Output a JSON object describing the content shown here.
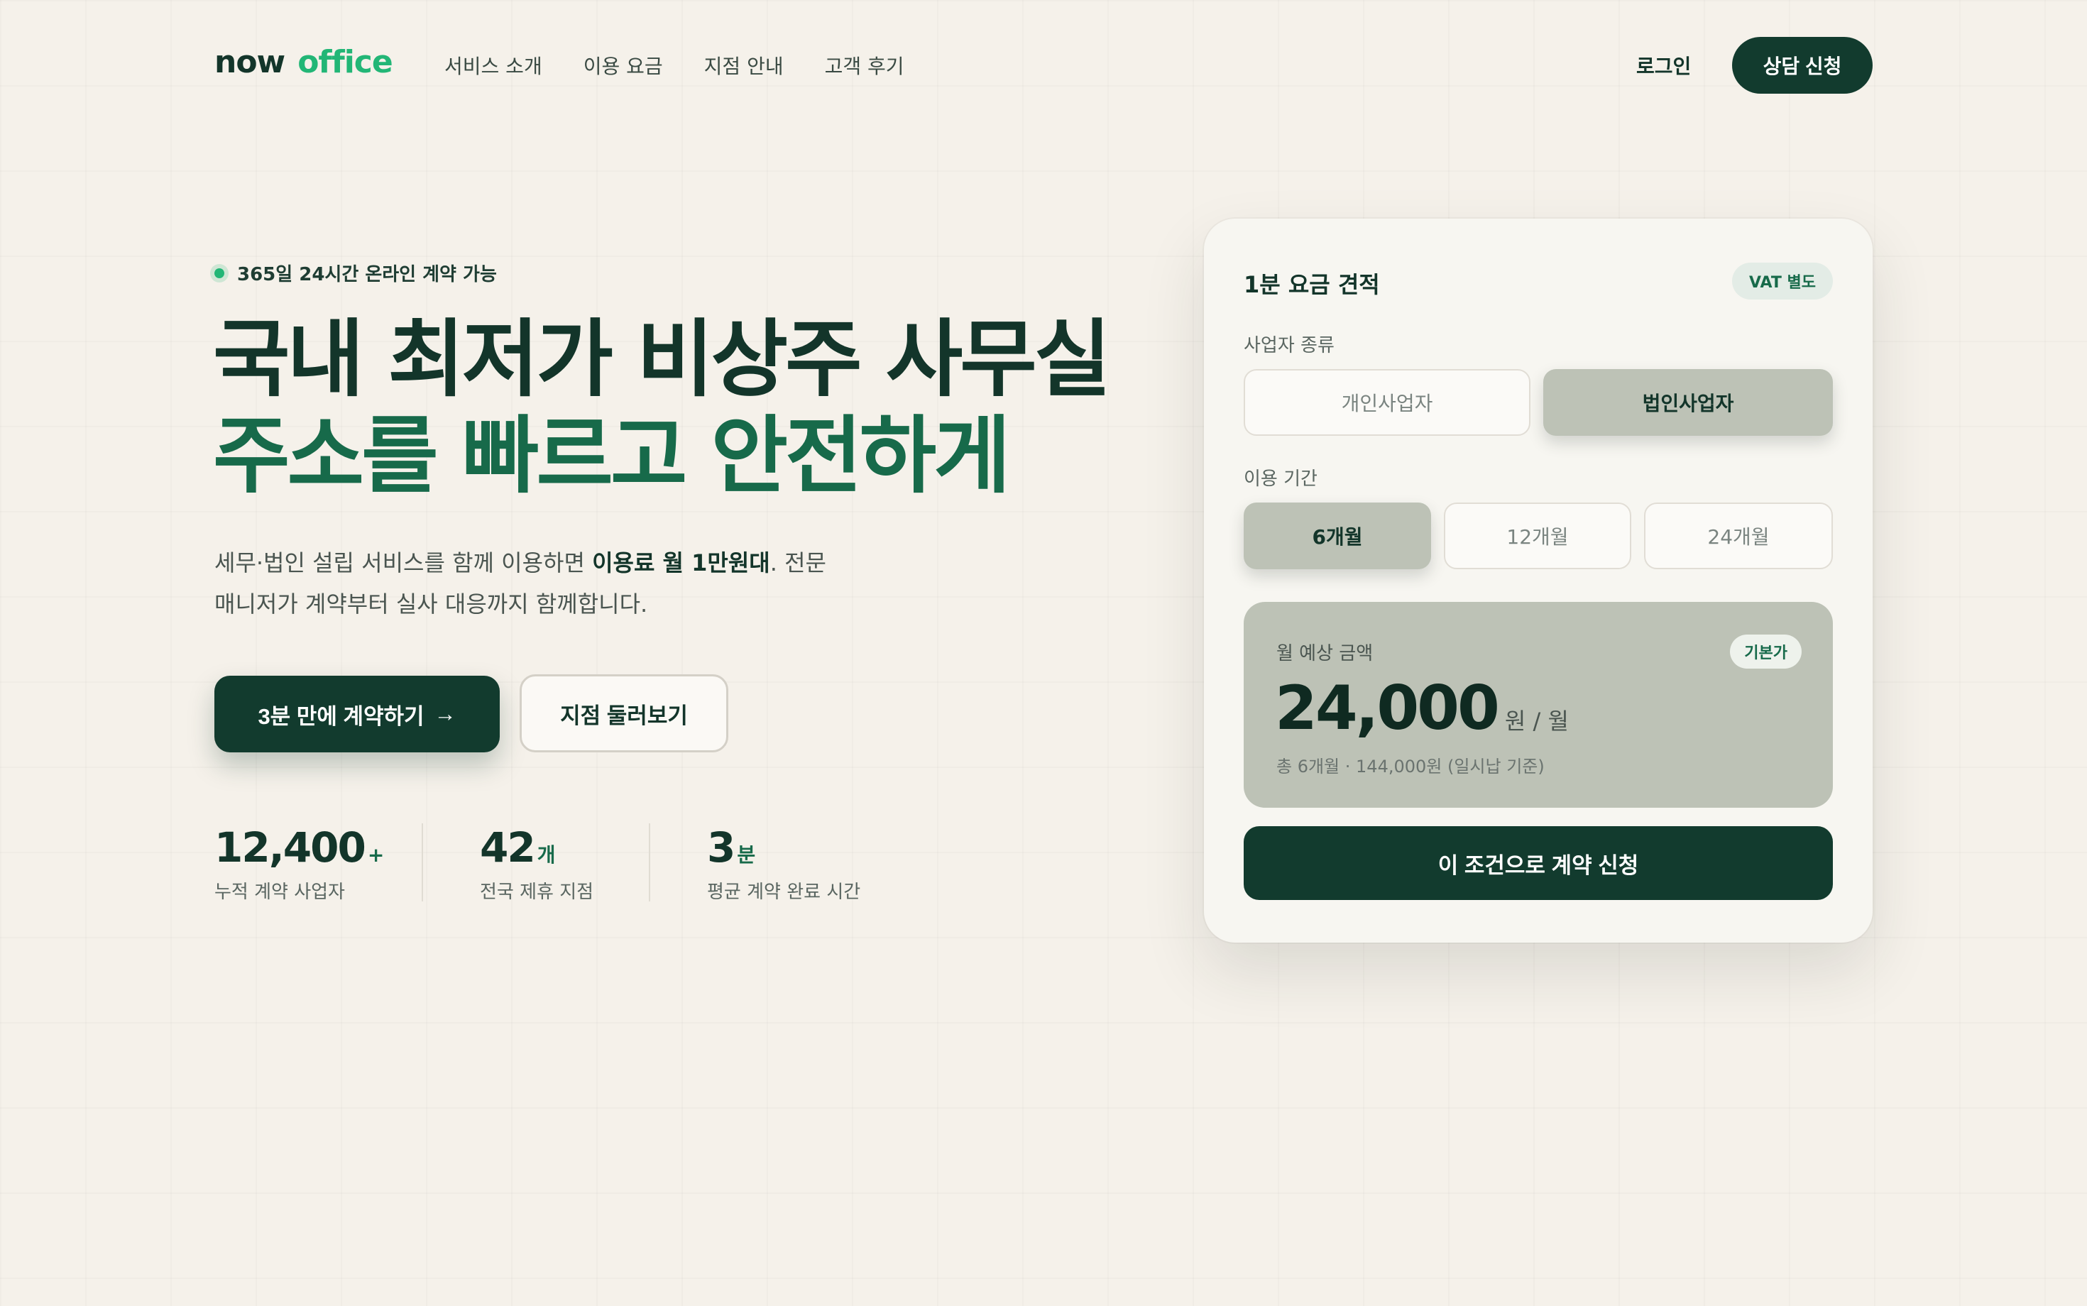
{
  "header": {
    "logo_now": "now",
    "logo_office": "office",
    "nav": [
      "서비스 소개",
      "이용 요금",
      "지점 안내",
      "고객 후기"
    ],
    "login": "로그인",
    "consult": "상담 신청"
  },
  "hero": {
    "badge": "365일 24시간 온라인 계약 가능",
    "title_line1": "국내 최저가 비상주 사무실",
    "title_line2": "주소를 빠르고 안전하게",
    "desc_prefix": "세무·법인 설립 서비스를 함께 이용하면 ",
    "desc_bold": "이용료 월 1만원대",
    "desc_suffix": ". 전문 매니저가 계약부터 실사 대응까지 함께합니다.",
    "cta_primary": "3분 만에 계약하기",
    "cta_primary_arrow": "→",
    "cta_secondary": "지점 둘러보기"
  },
  "stats": [
    {
      "value": "12,400",
      "unit": "+",
      "label": "누적 계약 사업자"
    },
    {
      "value": "42",
      "unit": "개",
      "label": "전국 제휴 지점"
    },
    {
      "value": "3",
      "unit": "분",
      "label": "평균 계약 완료 시간"
    }
  ],
  "quote": {
    "title": "1분 요금 견적",
    "vat": "VAT 별도",
    "biz_type_label": "사업자 종류",
    "biz_types": [
      "개인사업자",
      "법인사업자"
    ],
    "biz_selected": "법인사업자",
    "period_label": "이용 기간",
    "periods": [
      "6개월",
      "12개월",
      "24개월"
    ],
    "period_selected": "6개월",
    "estimate_label": "월 예상 금액",
    "base_badge": "기본가",
    "amount": "24,000",
    "amount_unit": "원 / 월",
    "amount_sub": "총 6개월 · 144,000원 (일시납 기준)",
    "apply": "이 조건으로 계약 신청"
  },
  "colors": {
    "background": "#f5f1ea",
    "primary_dark": "#123b2e",
    "accent_green": "#22b676",
    "title_green": "#176a4a",
    "selected_gray": "#bdc2b6"
  }
}
